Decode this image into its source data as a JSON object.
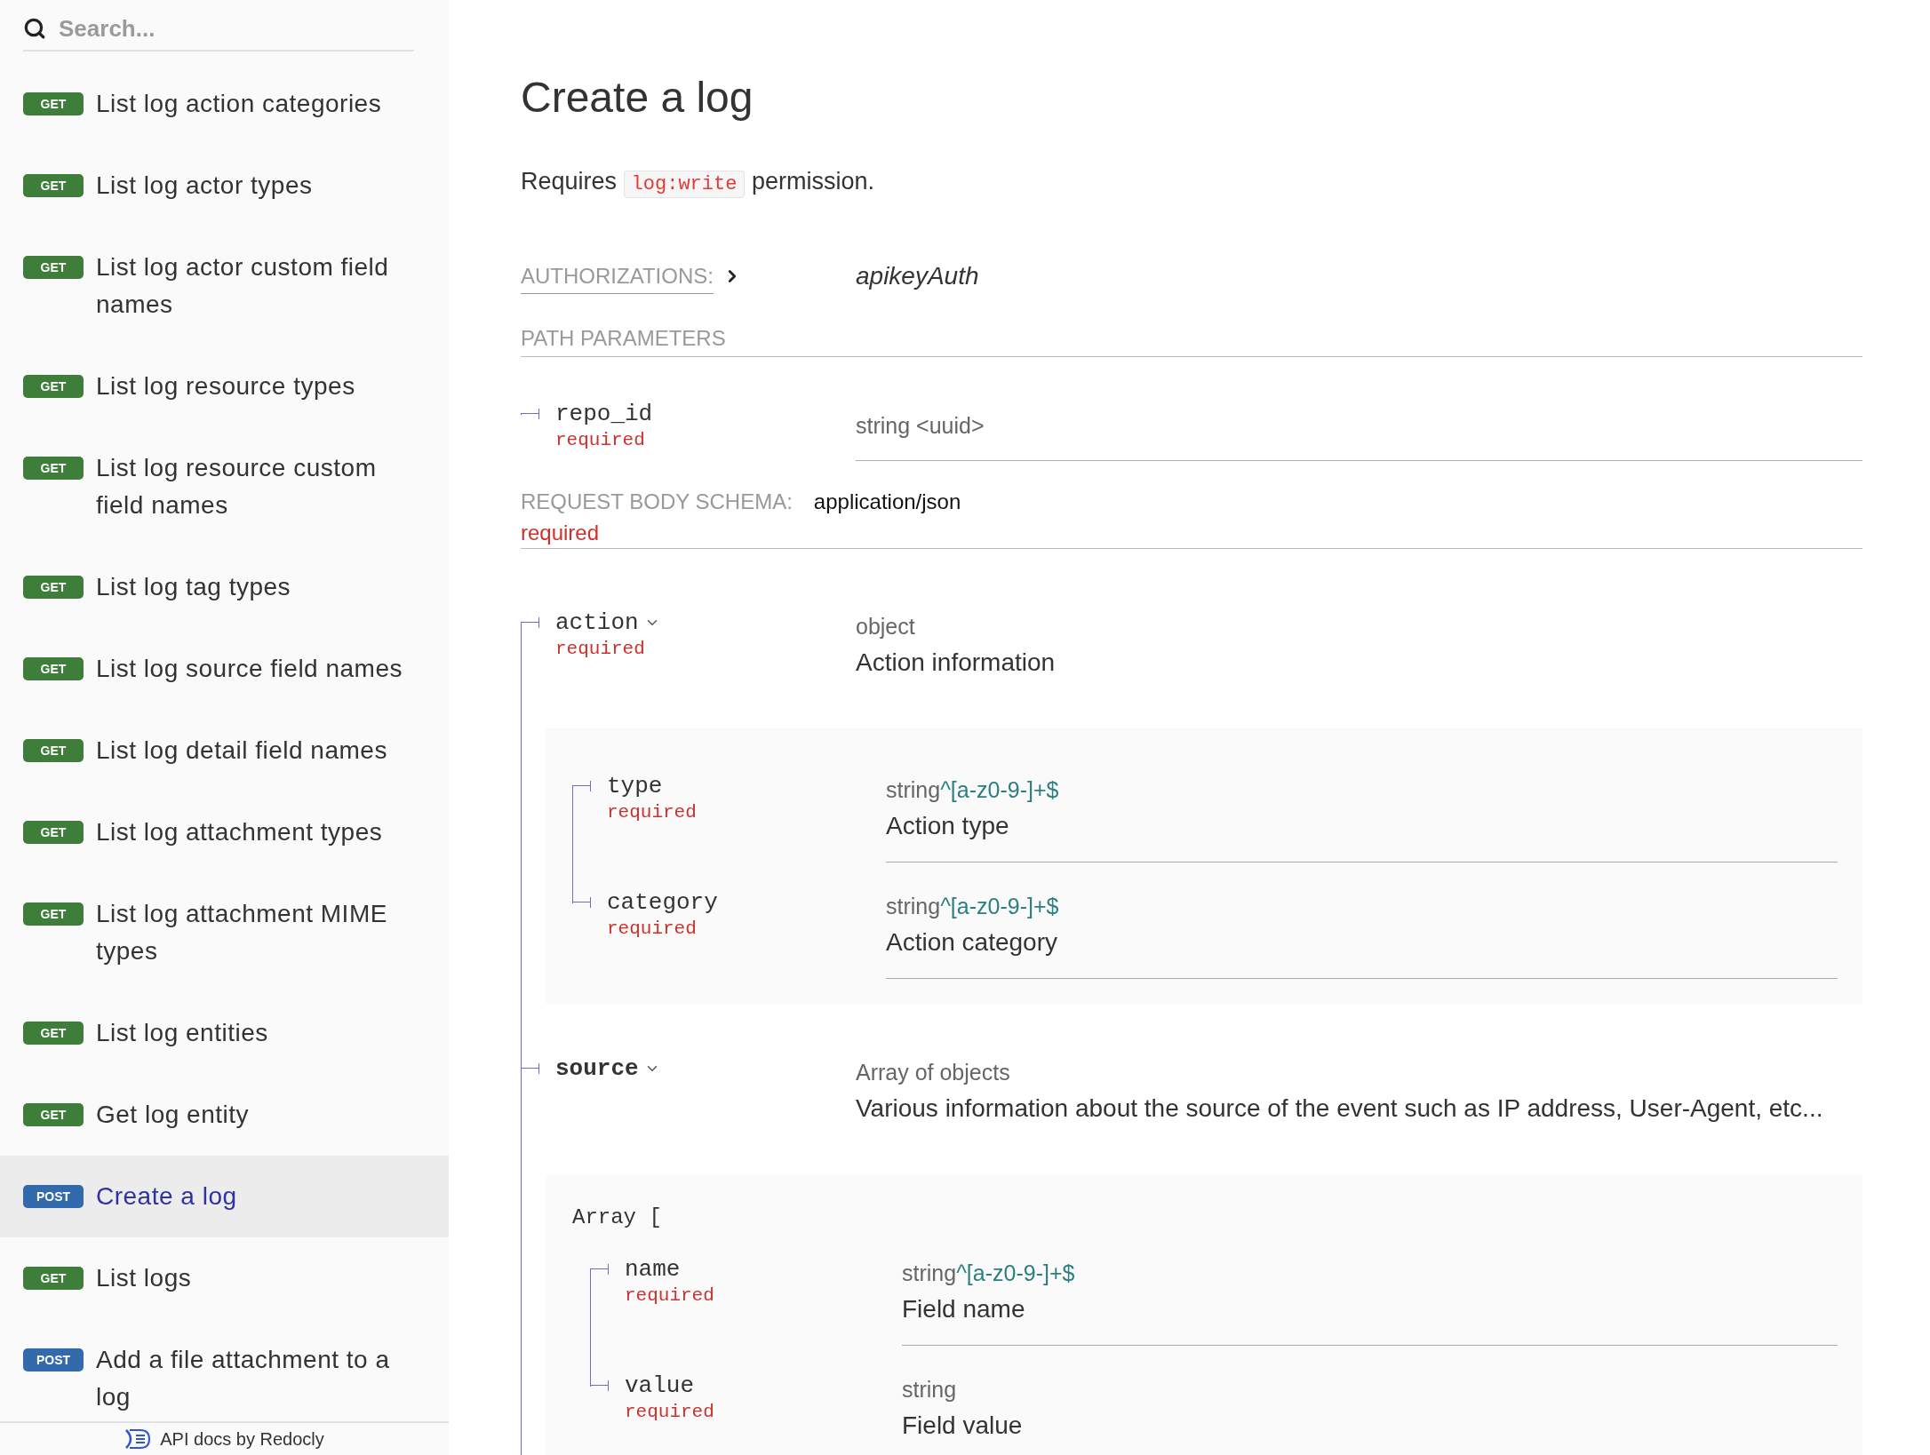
{
  "sidebar": {
    "search": {
      "placeholder": "Search..."
    },
    "items": [
      {
        "method": "GET",
        "label": "List log action categories",
        "selected": false
      },
      {
        "method": "GET",
        "label": "List log actor types",
        "selected": false
      },
      {
        "method": "GET",
        "label": "List log actor custom field names",
        "selected": false
      },
      {
        "method": "GET",
        "label": "List log resource types",
        "selected": false
      },
      {
        "method": "GET",
        "label": "List log resource custom field names",
        "selected": false
      },
      {
        "method": "GET",
        "label": "List log tag types",
        "selected": false
      },
      {
        "method": "GET",
        "label": "List log source field names",
        "selected": false
      },
      {
        "method": "GET",
        "label": "List log detail field names",
        "selected": false
      },
      {
        "method": "GET",
        "label": "List log attachment types",
        "selected": false
      },
      {
        "method": "GET",
        "label": "List log attachment MIME types",
        "selected": false
      },
      {
        "method": "GET",
        "label": "List log entities",
        "selected": false
      },
      {
        "method": "GET",
        "label": "Get log entity",
        "selected": false
      },
      {
        "method": "POST",
        "label": "Create a log",
        "selected": true
      },
      {
        "method": "GET",
        "label": "List logs",
        "selected": false
      },
      {
        "method": "POST",
        "label": "Add a file attachment to a log",
        "selected": false
      }
    ],
    "footer": "API docs by Redocly"
  },
  "main": {
    "title": "Create a log",
    "permission": {
      "before": "Requires",
      "code": "log:write",
      "after": "permission."
    },
    "authorizations": {
      "label": "AUTHORIZATIONS:",
      "value": "apikeyAuth"
    },
    "path_parameters": {
      "heading": "PATH PARAMETERS",
      "params": [
        {
          "name": "repo_id",
          "required": "required",
          "type": "string <uuid>"
        }
      ]
    },
    "request_body": {
      "label": "REQUEST BODY SCHEMA:",
      "media_type": "application/json",
      "required": "required",
      "fields": [
        {
          "kind": "object",
          "name": "action",
          "bold": false,
          "expanded": true,
          "required": "required",
          "type": "object",
          "description": "Action information",
          "children": [
            {
              "name": "type",
              "required": "required",
              "type": "string",
              "pattern": "^[a-z0-9-]+$",
              "description": "Action type"
            },
            {
              "name": "category",
              "required": "required",
              "type": "string",
              "pattern": "^[a-z0-9-]+$",
              "description": "Action category"
            }
          ]
        },
        {
          "kind": "array",
          "name": "source",
          "bold": true,
          "expanded": true,
          "type": "Array of objects",
          "description": "Various information about the source of the event such as IP address, User-Agent, etc...",
          "array_label": "Array [",
          "children": [
            {
              "name": "name",
              "required": "required",
              "type": "string",
              "pattern": "^[a-z0-9-]+$",
              "description": "Field name"
            },
            {
              "name": "value",
              "required": "required",
              "type": "string",
              "description": "Field value"
            }
          ]
        }
      ]
    }
  }
}
